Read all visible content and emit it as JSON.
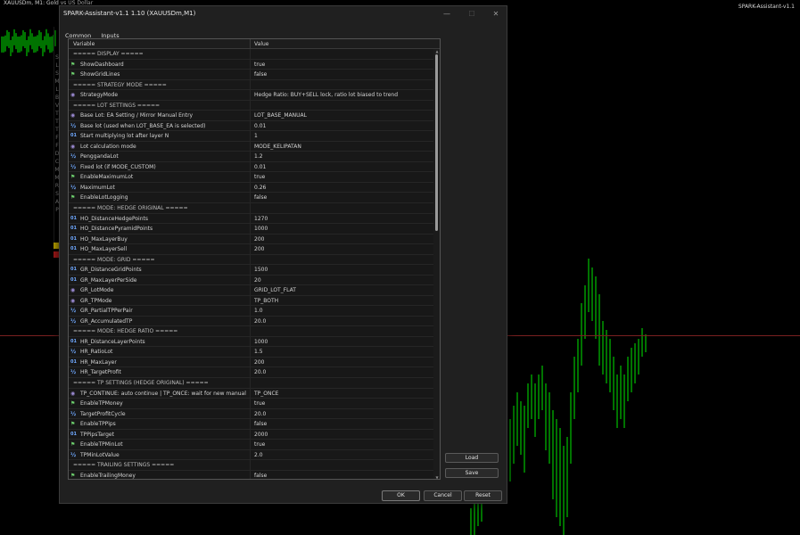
{
  "chart": {
    "symbol_label": "XAUUSDm, M1:  Gold vs US Dollar",
    "indicator_label": "SPARK-Assistant-v1.1",
    "side_letters": "S L S M L B V T T T F F D C M M R S A P",
    "colors": {
      "background": "#000000",
      "candles": "#00e600",
      "price_line": "#7a2020"
    }
  },
  "dialog": {
    "title": "SPARK-Assistant-v1.1 1.10 (XAUUSDm,M1)",
    "window_buttons": {
      "minimize": "—",
      "maximize": "☐",
      "close": "✕"
    },
    "tabs": [
      {
        "label": "Common"
      },
      {
        "label": "Inputs",
        "active": true
      }
    ],
    "table": {
      "col_variable": "Variable",
      "col_value": "Value",
      "rows": [
        {
          "icon": "none",
          "name": "===== DISPLAY =====",
          "value": "",
          "section": true
        },
        {
          "icon": "flag",
          "name": "ShowDashboard",
          "value": "true"
        },
        {
          "icon": "flag",
          "name": "ShowGridLines",
          "value": "false"
        },
        {
          "icon": "none",
          "name": "===== STRATEGY MODE =====",
          "value": "",
          "section": true
        },
        {
          "icon": "enum",
          "name": "StrategyMode",
          "value": "Hedge Ratio: BUY+SELL lock, ratio lot biased to trend"
        },
        {
          "icon": "none",
          "name": "===== LOT SETTINGS =====",
          "value": "",
          "section": true
        },
        {
          "icon": "enum",
          "name": "Base Lot: EA Setting / Mirror Manual Entry",
          "value": "LOT_BASE_MANUAL"
        },
        {
          "icon": "frac",
          "name": "Base lot (used when LOT_BASE_EA is selected)",
          "value": "0.01"
        },
        {
          "icon": "num",
          "name": "Start multiplying lot after layer N",
          "value": "1"
        },
        {
          "icon": "enum",
          "name": "Lot calculation mode",
          "value": "MODE_KELIPATAN"
        },
        {
          "icon": "frac",
          "name": "PenggandaLot",
          "value": "1.2"
        },
        {
          "icon": "frac",
          "name": "Fixed lot (if MODE_CUSTOM)",
          "value": "0.01"
        },
        {
          "icon": "flag",
          "name": "EnableMaximumLot",
          "value": "true"
        },
        {
          "icon": "frac",
          "name": "MaximumLot",
          "value": "0.26"
        },
        {
          "icon": "flag",
          "name": "EnableLotLogging",
          "value": "false"
        },
        {
          "icon": "none",
          "name": "===== MODE: HEDGE ORIGINAL =====",
          "value": "",
          "section": true
        },
        {
          "icon": "num",
          "name": "HO_DistanceHedgePoints",
          "value": "1270"
        },
        {
          "icon": "num",
          "name": "HO_DistancePyramidPoints",
          "value": "1000"
        },
        {
          "icon": "num",
          "name": "HO_MaxLayerBuy",
          "value": "200"
        },
        {
          "icon": "num",
          "name": "HO_MaxLayerSell",
          "value": "200"
        },
        {
          "icon": "none",
          "name": "===== MODE: GRID =====",
          "value": "",
          "section": true
        },
        {
          "icon": "num",
          "name": "GR_DistanceGridPoints",
          "value": "1500"
        },
        {
          "icon": "num",
          "name": "GR_MaxLayerPerSide",
          "value": "20"
        },
        {
          "icon": "enum",
          "name": "GR_LotMode",
          "value": "GRID_LOT_FLAT"
        },
        {
          "icon": "enum",
          "name": "GR_TPMode",
          "value": "TP_BOTH"
        },
        {
          "icon": "frac",
          "name": "GR_PartialTPPerPair",
          "value": "1.0"
        },
        {
          "icon": "frac",
          "name": "GR_AccumulatedTP",
          "value": "20.0"
        },
        {
          "icon": "none",
          "name": "===== MODE: HEDGE RATIO =====",
          "value": "",
          "section": true
        },
        {
          "icon": "num",
          "name": "HR_DistanceLayerPoints",
          "value": "1000"
        },
        {
          "icon": "frac",
          "name": "HR_RatioLot",
          "value": "1.5"
        },
        {
          "icon": "num",
          "name": "HR_MaxLayer",
          "value": "200"
        },
        {
          "icon": "frac",
          "name": "HR_TargetProfit",
          "value": "20.0"
        },
        {
          "icon": "none",
          "name": "===== TP SETTINGS (HEDGE ORIGINAL) =====",
          "value": "",
          "section": true
        },
        {
          "icon": "enum",
          "name": "TP_CONTINUE: auto continue | TP_ONCE: wait for new manual e...",
          "value": "TP_ONCE"
        },
        {
          "icon": "flag",
          "name": "EnableTPMoney",
          "value": "true"
        },
        {
          "icon": "frac",
          "name": "TargetProfitCycle",
          "value": "20.0"
        },
        {
          "icon": "flag",
          "name": "EnableTPPips",
          "value": "false"
        },
        {
          "icon": "num",
          "name": "TPPipsTarget",
          "value": "2000"
        },
        {
          "icon": "flag",
          "name": "EnableTPMinLot",
          "value": "true"
        },
        {
          "icon": "frac",
          "name": "TPMinLotValue",
          "value": "2.0"
        },
        {
          "icon": "none",
          "name": "===== TRAILING SETTINGS =====",
          "value": "",
          "section": true
        },
        {
          "icon": "flag",
          "name": "EnableTrailingMoney",
          "value": "false"
        }
      ]
    },
    "side_buttons": {
      "load": "Load",
      "save": "Save"
    },
    "footer_buttons": {
      "ok": "OK",
      "cancel": "Cancel",
      "reset": "Reset"
    }
  }
}
